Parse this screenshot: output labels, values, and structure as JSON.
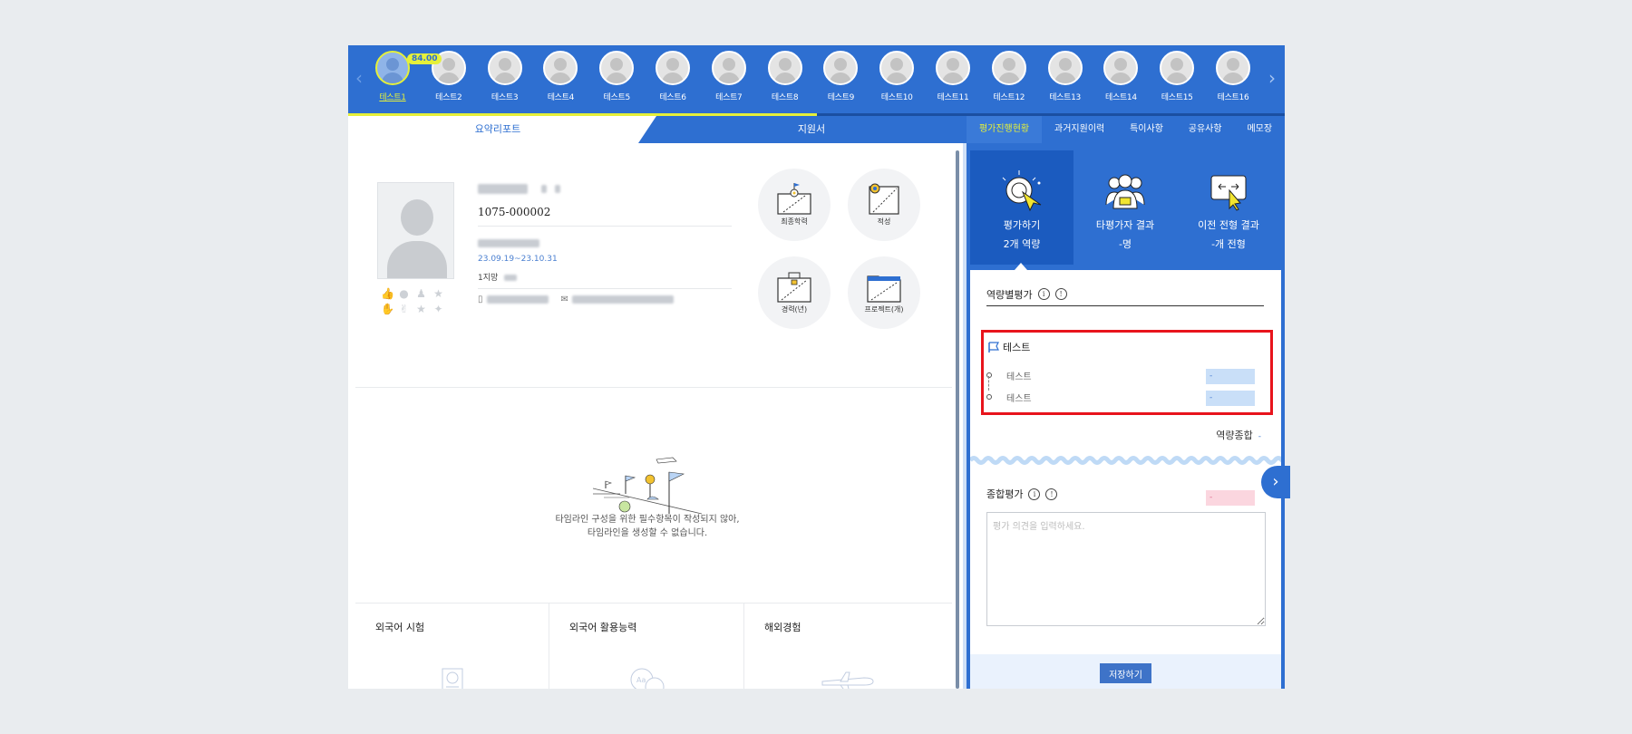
{
  "candidates": {
    "items": [
      {
        "name": "테스트1",
        "score": "84.00"
      },
      {
        "name": "테스트2"
      },
      {
        "name": "테스트3"
      },
      {
        "name": "테스트4"
      },
      {
        "name": "테스트5"
      },
      {
        "name": "테스트6"
      },
      {
        "name": "테스트7"
      },
      {
        "name": "테스트8"
      },
      {
        "name": "테스트9"
      },
      {
        "name": "테스트10"
      },
      {
        "name": "테스트11"
      },
      {
        "name": "테스트12"
      },
      {
        "name": "테스트13"
      },
      {
        "name": "테스트14"
      },
      {
        "name": "테스트15"
      },
      {
        "name": "테스트16"
      }
    ],
    "prev_icon": "chevron-left-icon",
    "next_icon": "chevron-right-icon",
    "progress_fraction": 0.5
  },
  "left_tabs": {
    "summary": "요약리포트",
    "application": "지원서"
  },
  "right_tabs": [
    "평가진행현황",
    "과거지원이력",
    "특이사항",
    "공유사항",
    "메모장"
  ],
  "profile": {
    "applicant_id": "1075-000002",
    "apply_period": "23.09.19~23.10.31",
    "preference": "1지망"
  },
  "docs": {
    "education": "최종학력",
    "aptitude": "적성",
    "career": "경력(년)",
    "project": "프로젝트(개)"
  },
  "timeline": {
    "message_line1": "타임라인 구성을 위한 필수항목이 작성되지 않아,",
    "message_line2": "타임라인을 생성할 수 없습니다."
  },
  "bottom": {
    "lang_test": "외국어 시험",
    "lang_ability": "외국어 활용능력",
    "overseas": "해외경험"
  },
  "eval_cards": {
    "evaluate_title": "평가하기",
    "evaluate_sub": "2개 역량",
    "others_title": "타평가자 결과",
    "others_sub": "-명",
    "prev_title": "이전 전형 결과",
    "prev_sub": "-개 전형"
  },
  "competency": {
    "section_title": "역량별평가",
    "group_name": "테스트",
    "items": [
      {
        "name": "테스트",
        "score": "-"
      },
      {
        "name": "테스트",
        "score": "-"
      }
    ],
    "total_label": "역량종합",
    "total_value": "-"
  },
  "overall": {
    "title": "종합평가",
    "score": "-",
    "placeholder": "평가 의견을 입력하세요."
  },
  "save_label": "저장하기",
  "colors": {
    "primary": "#2e6fd1",
    "accent_yellow": "#e5f03a",
    "highlight_red": "#e8141c"
  }
}
